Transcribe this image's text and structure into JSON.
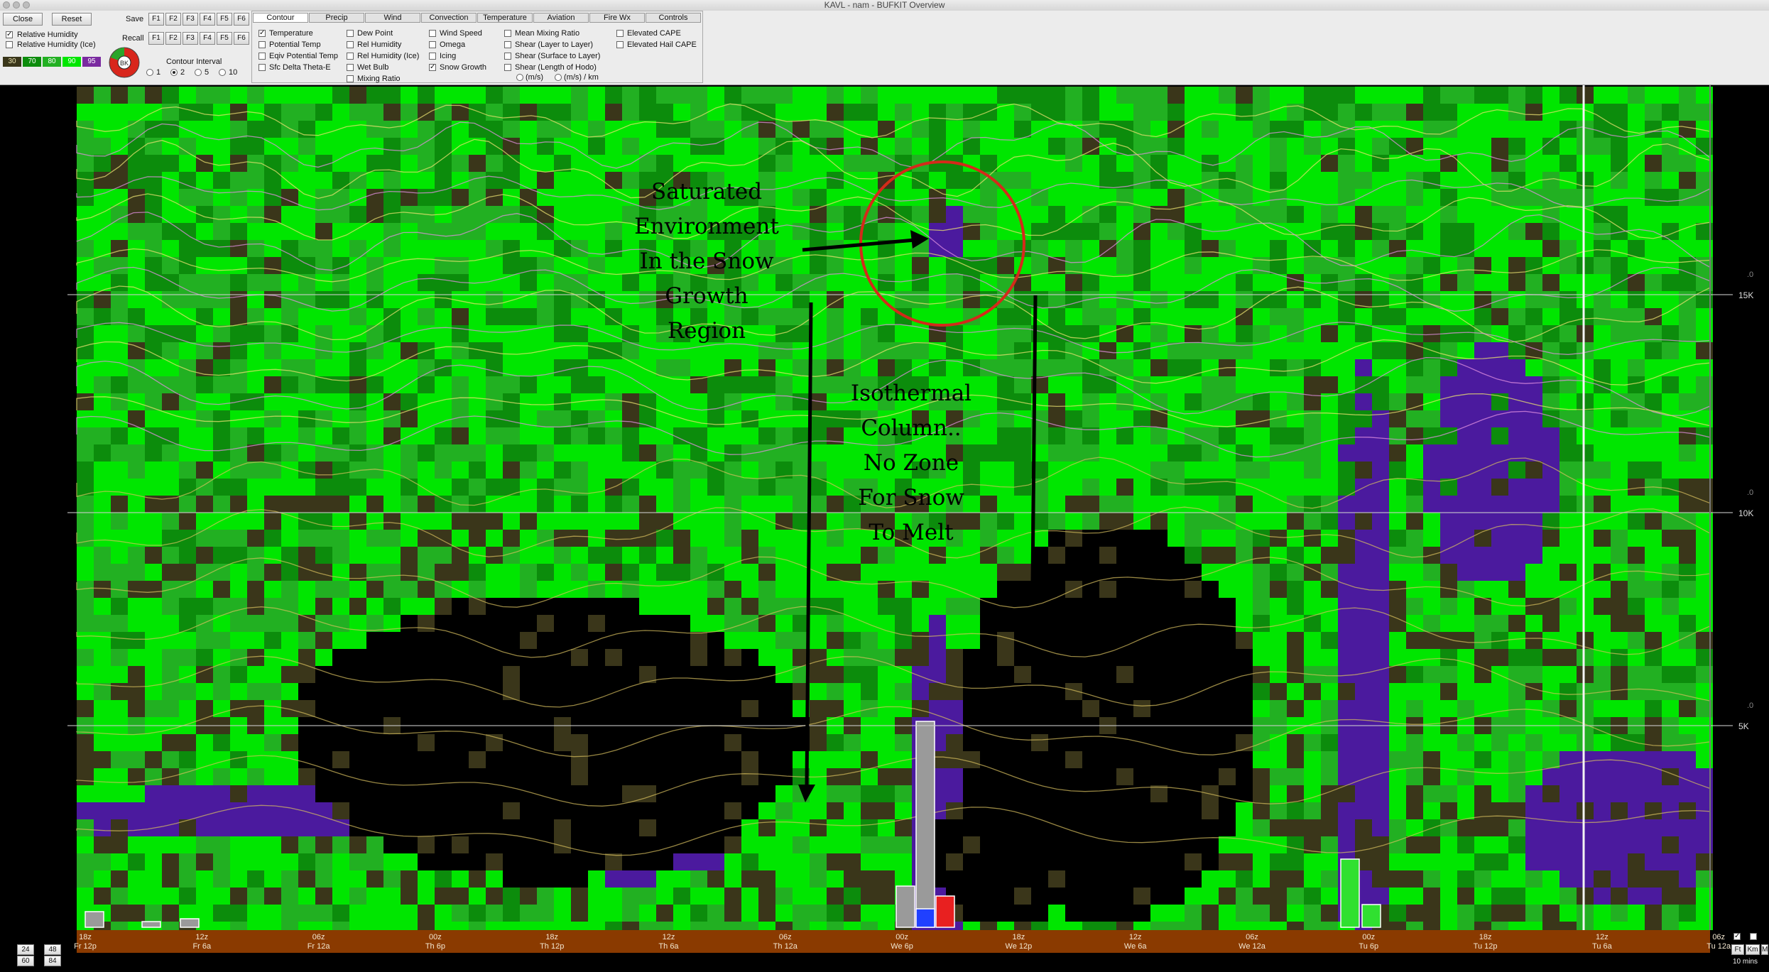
{
  "window": {
    "title": "KAVL - nam - BUFKIT Overview"
  },
  "toolbar": {
    "close_label": "Close",
    "reset_label": "Reset",
    "save_label": "Save",
    "recall_label": "Recall",
    "function_keys": [
      "F1",
      "F2",
      "F3",
      "F4",
      "F5",
      "F6"
    ],
    "rh_label": "Relative Humidity",
    "rh_ice_label": "Relative Humidity (Ice)",
    "rh_scale": [
      "30",
      "70",
      "80",
      "90",
      "95"
    ],
    "contour_interval_label": "Contour Interval",
    "contour_intervals": [
      "1",
      "2",
      "5",
      "10"
    ]
  },
  "tabs": [
    "Contour",
    "Precip",
    "Wind",
    "Convection",
    "Temperature",
    "Aviation",
    "Fire Wx",
    "Controls"
  ],
  "options": {
    "col1": [
      "Temperature",
      "Potential Temp",
      "Eqiv Potential Temp",
      "Sfc Delta Theta-E"
    ],
    "col2": [
      "Dew Point",
      "Rel Humidity",
      "Rel Humidity (Ice)",
      "Wet Bulb",
      "Mixing Ratio"
    ],
    "col3": [
      "Wind Speed",
      "Omega",
      "Icing",
      "Snow Growth"
    ],
    "col4": [
      "Mean Mixing Ratio",
      "Shear (Layer to Layer)",
      "Shear (Surface to Layer)",
      "Shear (Length of Hodo)"
    ],
    "col5": [
      "Elevated CAPE",
      "Elevated Hail CAPE"
    ],
    "shear_units": [
      "(m/s)",
      "(m/s) / km"
    ]
  },
  "plot": {
    "height_labels": [
      "15K",
      "10K",
      "5K"
    ],
    "right_edge_value": ".0"
  },
  "annotations": {
    "saturated": [
      "Saturated",
      "Environment",
      "In the Snow",
      "Growth",
      "Region"
    ],
    "isothermal": [
      "Isothermal",
      "Column..",
      "No Zone",
      "For Snow",
      "To Melt"
    ]
  },
  "timeline": {
    "ticks": [
      {
        "z": "18z",
        "local": "Fr 12p"
      },
      {
        "z": "12z",
        "local": "Fr 6a"
      },
      {
        "z": "06z",
        "local": "Fr 12a"
      },
      {
        "z": "00z",
        "local": "Th 6p"
      },
      {
        "z": "18z",
        "local": "Th 12p"
      },
      {
        "z": "12z",
        "local": "Th 6a"
      },
      {
        "z": "06z",
        "local": "Th 12a"
      },
      {
        "z": "00z",
        "local": "We 6p"
      },
      {
        "z": "18z",
        "local": "We 12p"
      },
      {
        "z": "12z",
        "local": "We 6a"
      },
      {
        "z": "06z",
        "local": "We 12a"
      },
      {
        "z": "00z",
        "local": "Tu 6p"
      },
      {
        "z": "18z",
        "local": "Tu 12p"
      },
      {
        "z": "12z",
        "local": "Tu 6a"
      },
      {
        "z": "06z",
        "local": "Tu 12a"
      }
    ],
    "range_buttons": [
      "24",
      "48",
      "60",
      "84"
    ],
    "unit_buttons": [
      "Ft",
      "Km",
      "M"
    ],
    "interval_label": "10 mins"
  },
  "colors": {
    "rh_95": "#4b1a9e",
    "rh_90": "#00e600",
    "rh_80": "#22b022",
    "rh_70": "#0c8c0c",
    "rh_30": "#3a361a",
    "dry": "#000000",
    "timebar": "#8a3a00",
    "circle": "#d42a1a"
  }
}
